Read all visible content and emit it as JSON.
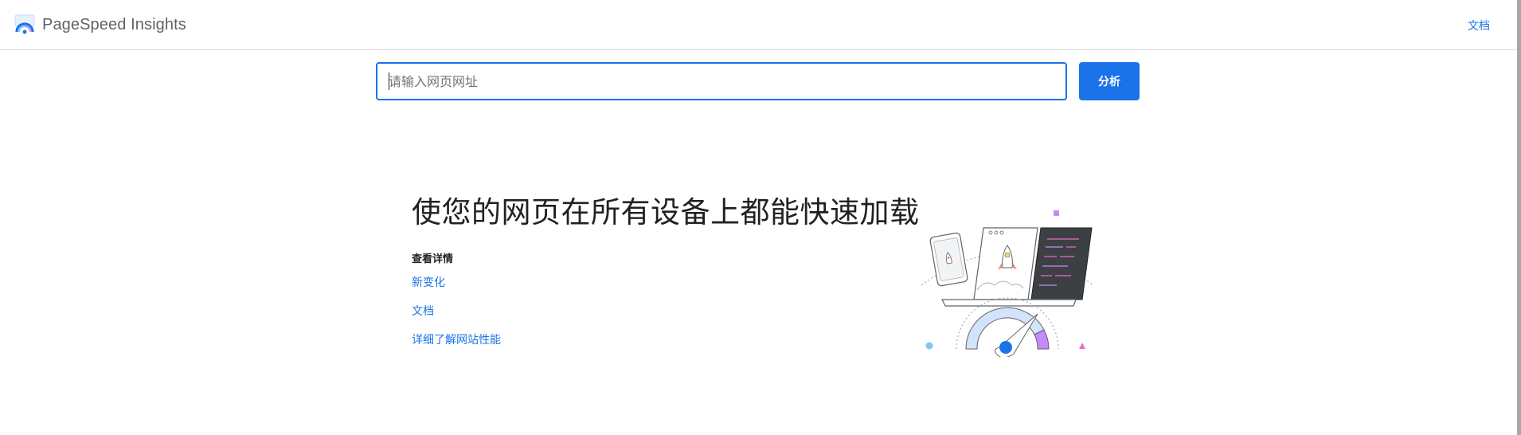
{
  "header": {
    "app_name": "PageSpeed Insights",
    "docs_link": "文档"
  },
  "search": {
    "placeholder": "请输入网页网址",
    "value": "",
    "analyze_label": "分析"
  },
  "hero": {
    "title": "使您的网页在所有设备上都能快速加载",
    "details_heading": "查看详情",
    "links": [
      "新变化",
      "文档",
      "详细了解网站性能"
    ]
  },
  "colors": {
    "accent": "#1a73e8",
    "text": "#202124",
    "muted": "#5f6368",
    "border": "#dadce0",
    "purple": "#c58af9",
    "pink": "#f06ac9",
    "light_blue": "#7cc8f8"
  }
}
